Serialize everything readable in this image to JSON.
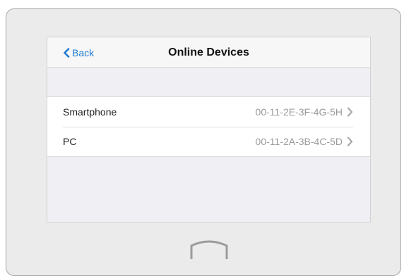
{
  "nav": {
    "back_label": "Back",
    "title": "Online Devices"
  },
  "devices": [
    {
      "name": "Smartphone",
      "mac": "00-11-2E-3F-4G-5H"
    },
    {
      "name": "PC",
      "mac": "00-11-2A-3B-4C-5D"
    }
  ],
  "icons": {
    "back": "chevron-left-icon",
    "row_arrow": "chevron-right-icon",
    "home": "home-button-icon"
  },
  "colors": {
    "accent": "#1e7ad2",
    "secondary_text": "#9a9a9a"
  }
}
